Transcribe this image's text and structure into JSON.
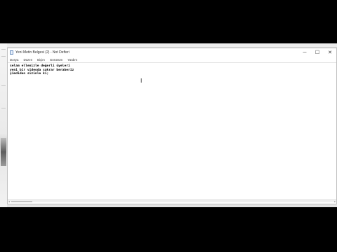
{
  "window": {
    "title": "Yeni Metin Belgesi (2) - Not Defteri",
    "controls": {
      "minimize": "─",
      "maximize": "☐",
      "close": "✕"
    }
  },
  "menu": {
    "items": [
      "Dosya",
      "Düzen",
      "Biçim",
      "Görünüm",
      "Yardım"
    ]
  },
  "editor": {
    "lines": [
      "selam ellenizle değerli üyeleri",
      "yeni bir videoda sakrar beraberiz",
      "şimdiden sizinle ki;"
    ]
  },
  "cursor": {
    "glyph": "I"
  },
  "scrollbar": {
    "left_arrow": "◀",
    "right_arrow": "▶"
  }
}
